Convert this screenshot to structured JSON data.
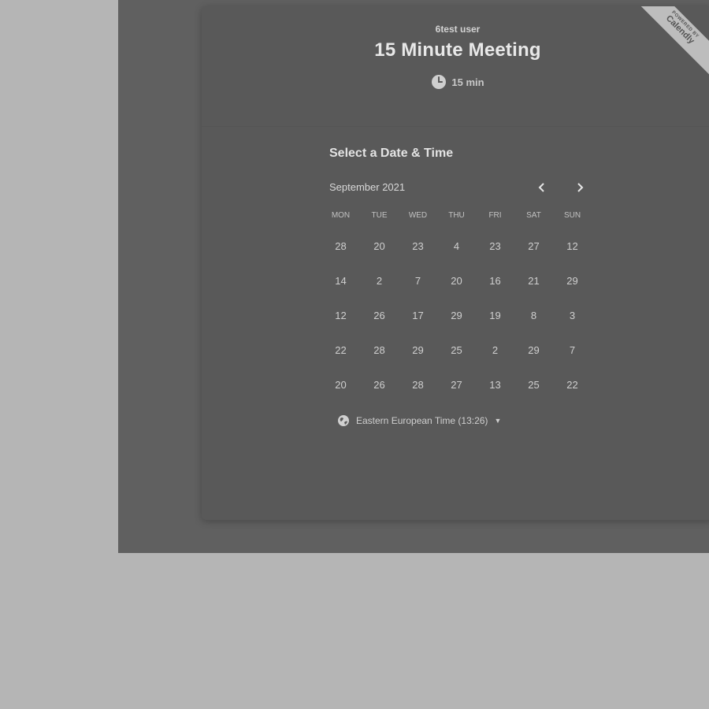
{
  "event": {
    "host": "6test user",
    "title": "15 Minute Meeting",
    "duration": "15 min"
  },
  "badge": {
    "top": "POWERED BY",
    "brand": "Calendly"
  },
  "picker": {
    "title": "Select a Date & Time",
    "month": "September 2021",
    "prev_icon": "chevron-left-icon",
    "next_icon": "chevron-right-icon",
    "weekdays": [
      "MON",
      "TUE",
      "WED",
      "THU",
      "FRI",
      "SAT",
      "SUN"
    ],
    "days": [
      "28",
      "20",
      "23",
      "4",
      "23",
      "27",
      "12",
      "14",
      "2",
      "7",
      "20",
      "16",
      "21",
      "29",
      "12",
      "26",
      "17",
      "29",
      "19",
      "8",
      "3",
      "22",
      "28",
      "29",
      "25",
      "2",
      "29",
      "7",
      "20",
      "26",
      "28",
      "27",
      "13",
      "25",
      "22"
    ]
  },
  "timezone": {
    "label": "Eastern European Time (13:26)",
    "icon": "globe-icon"
  }
}
